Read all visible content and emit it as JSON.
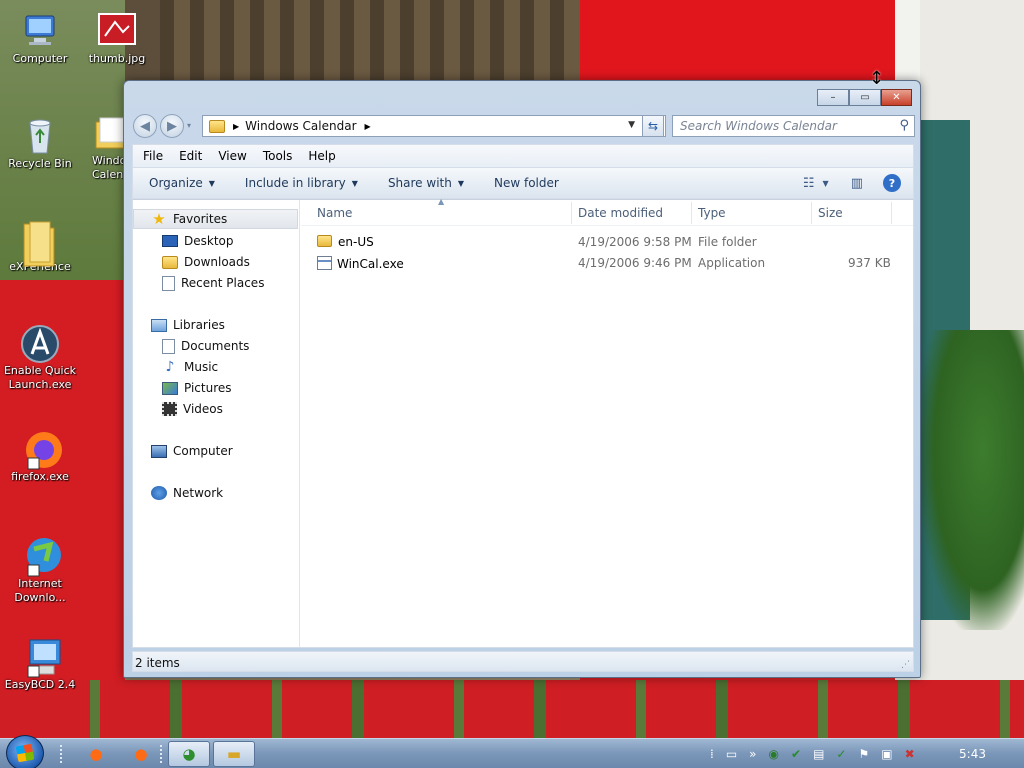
{
  "desktop": {
    "icons": [
      {
        "label": "Computer",
        "icon": "computer-icon"
      },
      {
        "label": "thumb.jpg",
        "icon": "image-file-icon"
      },
      {
        "label": "Recycle Bin",
        "icon": "recycle-bin-icon"
      },
      {
        "label": "Windows Calendar",
        "icon": "folder-icon"
      },
      {
        "label": "eXPerience",
        "icon": "folder-icon"
      },
      {
        "label": "Enable Quick Launch.exe",
        "icon": "app-icon"
      },
      {
        "label": "firefox.exe",
        "icon": "firefox-icon"
      },
      {
        "label": "Internet Downlo...",
        "icon": "internet-download-icon"
      },
      {
        "label": "EasyBCD 2.4",
        "icon": "easybcd-icon"
      }
    ],
    "partial_labels": {
      "line1": "Windo",
      "line2": "Calen"
    }
  },
  "window": {
    "title": "",
    "controls": {
      "minimize": "–",
      "maximize": "▭",
      "close": "✕"
    },
    "address": {
      "segment": "Windows Calendar"
    },
    "search": {
      "placeholder": "Search Windows Calendar"
    },
    "menu": [
      "File",
      "Edit",
      "View",
      "Tools",
      "Help"
    ],
    "toolbar": {
      "organize": "Organize",
      "include": "Include in library",
      "share": "Share with",
      "new_folder": "New folder"
    },
    "nav": {
      "favorites": "Favorites",
      "favorite_items": [
        "Desktop",
        "Downloads",
        "Recent Places"
      ],
      "libraries": "Libraries",
      "library_items": [
        "Documents",
        "Music",
        "Pictures",
        "Videos"
      ],
      "computer": "Computer",
      "network": "Network"
    },
    "columns": {
      "name": "Name",
      "date": "Date modified",
      "type": "Type",
      "size": "Size"
    },
    "files": [
      {
        "name": "en-US",
        "date": "4/19/2006 9:58 PM",
        "type": "File folder",
        "size": ""
      },
      {
        "name": "WinCal.exe",
        "date": "4/19/2006 9:46 PM",
        "type": "Application",
        "size": "937 KB"
      }
    ],
    "status": "2 items"
  },
  "taskbar": {
    "clock": "5:43"
  },
  "colors": {
    "accent": "#1e395b",
    "window_frame": "#bcd0e6",
    "close_red": "#c8402a"
  }
}
